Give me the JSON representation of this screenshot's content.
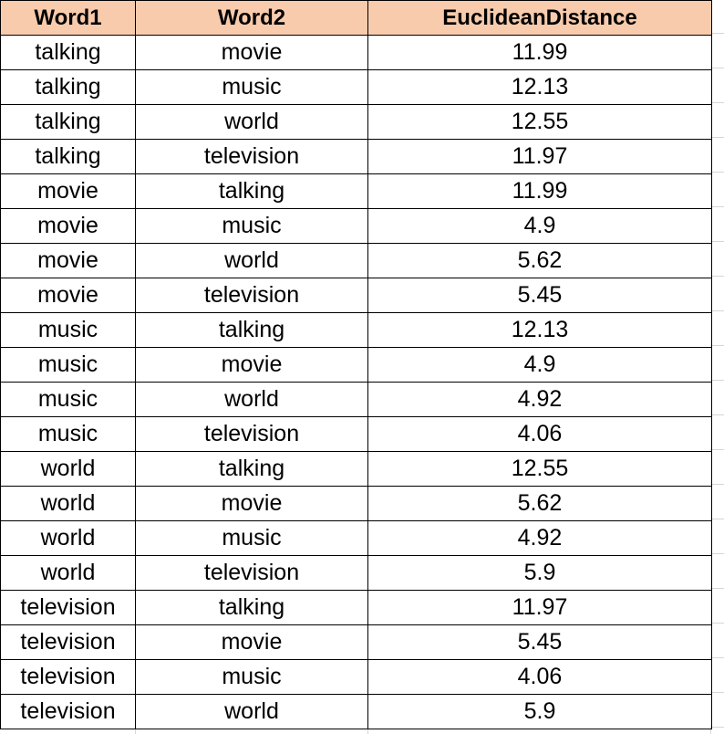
{
  "colors": {
    "header_fill": "#f8cbad",
    "border": "#000000",
    "gridline": "#d6d6d6"
  },
  "table": {
    "headers": [
      "Word1",
      "Word2",
      "EuclideanDistance"
    ],
    "rows": [
      [
        "talking",
        "movie",
        "11.99"
      ],
      [
        "talking",
        "music",
        "12.13"
      ],
      [
        "talking",
        "world",
        "12.55"
      ],
      [
        "talking",
        "television",
        "11.97"
      ],
      [
        "movie",
        "talking",
        "11.99"
      ],
      [
        "movie",
        "music",
        "4.9"
      ],
      [
        "movie",
        "world",
        "5.62"
      ],
      [
        "movie",
        "television",
        "5.45"
      ],
      [
        "music",
        "talking",
        "12.13"
      ],
      [
        "music",
        "movie",
        "4.9"
      ],
      [
        "music",
        "world",
        "4.92"
      ],
      [
        "music",
        "television",
        "4.06"
      ],
      [
        "world",
        "talking",
        "12.55"
      ],
      [
        "world",
        "movie",
        "5.62"
      ],
      [
        "world",
        "music",
        "4.92"
      ],
      [
        "world",
        "television",
        "5.9"
      ],
      [
        "television",
        "talking",
        "11.97"
      ],
      [
        "television",
        "movie",
        "5.45"
      ],
      [
        "television",
        "music",
        "4.06"
      ],
      [
        "television",
        "world",
        "5.9"
      ]
    ]
  }
}
